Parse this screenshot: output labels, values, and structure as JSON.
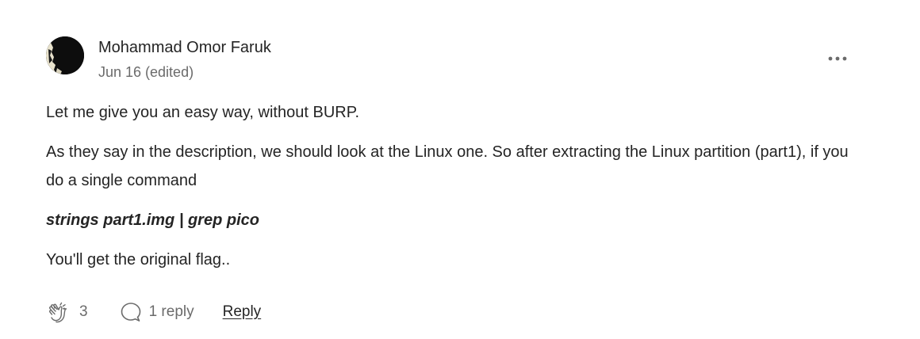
{
  "comment": {
    "author": "Mohammad Omor Faruk",
    "date": "Jun 16 (edited)",
    "more_icon": "more-horizontal-icon",
    "paragraphs": [
      "Let me give you an easy way, without BURP.",
      "As they say in the description, we should look at the Linux one. So after extracting the Linux partition (part1), if you do a single command"
    ],
    "command": "strings part1.img | grep pico",
    "closing": "You'll get the original flag.."
  },
  "footer": {
    "clap_icon": "clap-icon",
    "clap_count": "3",
    "response_icon": "speech-bubble-icon",
    "replies": "1 reply",
    "reply_label": "Reply"
  },
  "colors": {
    "text": "#242424",
    "muted": "#6b6b6b",
    "background": "#ffffff"
  }
}
